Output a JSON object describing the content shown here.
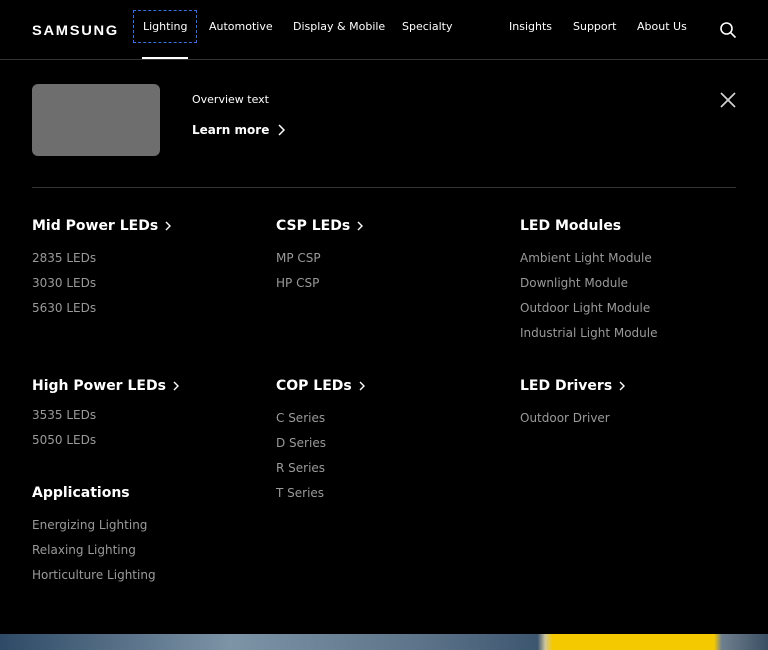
{
  "header": {
    "logo": "SAMSUNG",
    "nav_left": [
      "Lighting",
      "Automotive",
      "Display & Mobile",
      "Specialty"
    ],
    "nav_right": [
      "Insights",
      "Support",
      "About Us"
    ],
    "search_icon": "search-icon",
    "active_item": "Lighting"
  },
  "overview": {
    "text": "Overview text",
    "learn_more": "Learn more",
    "close_icon": "close-icon"
  },
  "categories": {
    "mid_power": {
      "title": "Mid Power LEDs",
      "items": [
        "2835 LEDs",
        "3030 LEDs",
        "5630 LEDs"
      ]
    },
    "csp": {
      "title": "CSP LEDs",
      "items": [
        "MP CSP",
        "HP CSP"
      ]
    },
    "led_modules": {
      "title": "LED Modules",
      "items": [
        "Ambient Light Module",
        "Downlight Module",
        "Outdoor Light Module",
        "Industrial Light Module"
      ]
    },
    "high_power": {
      "title": "High Power LEDs",
      "items": [
        "3535 LEDs",
        "5050 LEDs"
      ]
    },
    "cop": {
      "title": "COP LEDs",
      "items": [
        "C Series",
        "D Series",
        "R Series",
        "T Series"
      ]
    },
    "led_drivers": {
      "title": "LED Drivers",
      "items": [
        "Outdoor Driver"
      ]
    },
    "applications": {
      "title": "Applications",
      "items": [
        "Energizing Lighting",
        "Relaxing Lighting",
        "Horticulture Lighting"
      ]
    }
  },
  "colors": {
    "background": "#000000",
    "text": "#ffffff",
    "subtext": "#9a9a9a",
    "focus_outline": "#3b6fe0",
    "placeholder_image": "#6e6e6e"
  }
}
